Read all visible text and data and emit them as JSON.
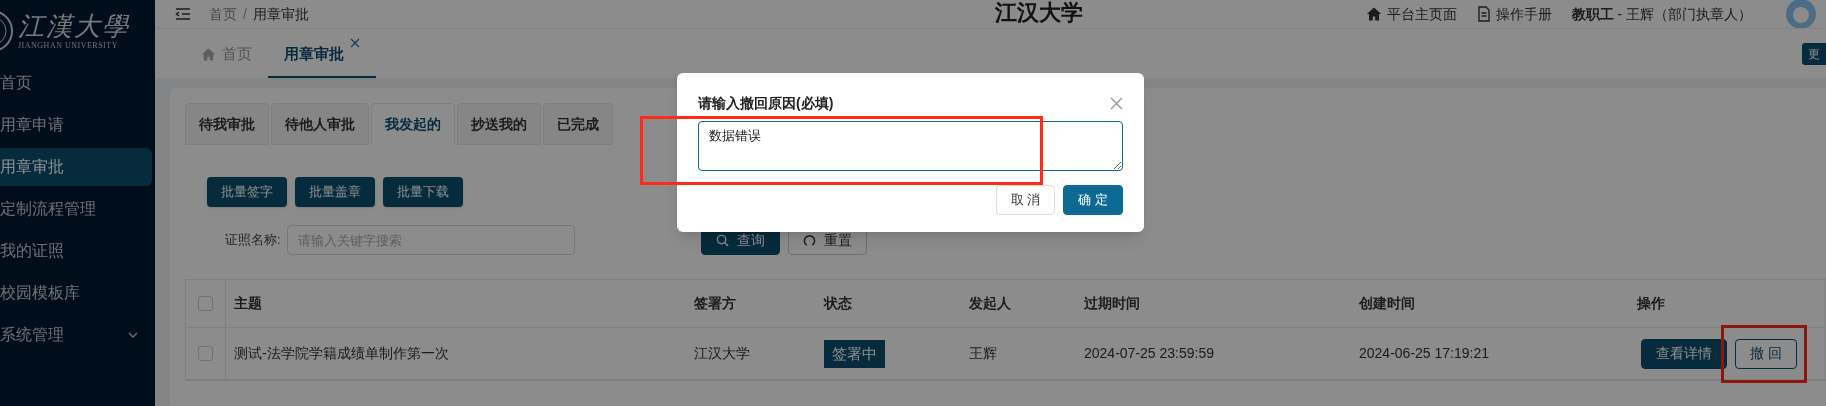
{
  "sidebar": {
    "logo": {
      "name": "江漢大學",
      "subtitle": "JIANGHAN UNIVERSITY"
    },
    "items": [
      {
        "label": "首页",
        "selected": false,
        "expandable": false
      },
      {
        "label": "用章申请",
        "selected": false,
        "expandable": false
      },
      {
        "label": "用章审批",
        "selected": true,
        "expandable": false
      },
      {
        "label": "定制流程管理",
        "selected": false,
        "expandable": false
      },
      {
        "label": "我的证照",
        "selected": false,
        "expandable": false
      },
      {
        "label": "校园模板库",
        "selected": false,
        "expandable": false
      },
      {
        "label": "系统管理",
        "selected": false,
        "expandable": true
      }
    ]
  },
  "header": {
    "breadcrumb": [
      "首页",
      "用章审批"
    ],
    "breadcrumb_separator": "/",
    "title": "江汉大学",
    "links": [
      {
        "kind": "home",
        "label": "平台主页面"
      },
      {
        "kind": "manual",
        "label": "操作手册"
      }
    ],
    "user": {
      "role": "教职工",
      "name": " - 王辉（部门执章人）"
    }
  },
  "page_tabs": [
    {
      "label": "首页",
      "kind": "home",
      "selected": false,
      "closable": false
    },
    {
      "label": "用章审批",
      "kind": "plain",
      "selected": true,
      "closable": true
    }
  ],
  "more_button": "更",
  "filter_tabs": [
    {
      "label": "待我审批",
      "selected": false
    },
    {
      "label": "待他人审批",
      "selected": false
    },
    {
      "label": "我发起的",
      "selected": true
    },
    {
      "label": "抄送我的",
      "selected": false
    },
    {
      "label": "已完成",
      "selected": false
    }
  ],
  "batch_buttons": [
    "批量签字",
    "批量盖章",
    "批量下载"
  ],
  "search": {
    "label": "证照名称:",
    "placeholder": "请输入关键字搜索",
    "buttons": [
      {
        "kind": "search",
        "label": "查询"
      },
      {
        "kind": "reset",
        "label": "重置"
      }
    ]
  },
  "table": {
    "all_checked": false,
    "columns": [
      "主题",
      "签署方",
      "状态",
      "发起人",
      "过期时间",
      "创建时间",
      "操作"
    ],
    "rows": [
      {
        "checked": false,
        "subject": "测试-法学院学籍成绩单制作第一次",
        "signer": "江汉大学",
        "status": "签署中",
        "initiator": "王辉",
        "expires": "2024-07-25 23:59:59",
        "created": "2024-06-25 17:19:21",
        "actions": [
          {
            "kind": "primary",
            "label": "查看详情",
            "highlighted": false
          },
          {
            "kind": "outline",
            "label": "撤 回",
            "highlighted": true
          }
        ]
      }
    ]
  },
  "dialog": {
    "title": "请输入撤回原因(必填)",
    "value": "数据错误",
    "highlighted": true,
    "buttons": [
      {
        "kind": "default",
        "label": "取 消"
      },
      {
        "kind": "primary",
        "label": "确 定"
      }
    ]
  }
}
